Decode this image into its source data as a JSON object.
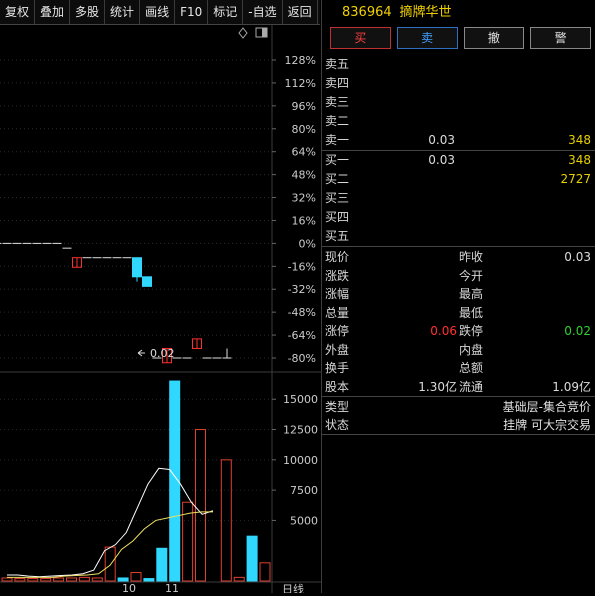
{
  "toolbar": [
    "复权",
    "叠加",
    "多股",
    "统计",
    "画线",
    "F10",
    "标记",
    "-自选",
    "返回"
  ],
  "chart_icons": [
    "diamond-icon",
    "window-icon"
  ],
  "price_axis": [
    "128%",
    "112%",
    "96%",
    "80%",
    "64%",
    "48%",
    "32%",
    "16%",
    "0%",
    "-16%",
    "-32%",
    "-48%",
    "-64%",
    "-80%"
  ],
  "volume_axis": [
    "15000",
    "12500",
    "10000",
    "7500",
    "5000"
  ],
  "date_labels": [
    "10",
    "11"
  ],
  "period_label": "日线",
  "min_label": "0.02",
  "stock": {
    "code": "836964",
    "name": "摘牌华世"
  },
  "trade_buttons": {
    "buy": "买",
    "sell": "卖",
    "cancel": "撤",
    "warn": "警"
  },
  "sell_levels": [
    {
      "label": "卖五",
      "price": "",
      "vol": ""
    },
    {
      "label": "卖四",
      "price": "",
      "vol": ""
    },
    {
      "label": "卖三",
      "price": "",
      "vol": ""
    },
    {
      "label": "卖二",
      "price": "",
      "vol": ""
    },
    {
      "label": "卖一",
      "price": "0.03",
      "vol": "348"
    }
  ],
  "buy_levels": [
    {
      "label": "买一",
      "price": "0.03",
      "vol": "348"
    },
    {
      "label": "买二",
      "price": "",
      "vol": "2727"
    },
    {
      "label": "买三",
      "price": "",
      "vol": ""
    },
    {
      "label": "买四",
      "price": "",
      "vol": ""
    },
    {
      "label": "买五",
      "price": "",
      "vol": ""
    }
  ],
  "info": [
    {
      "l1": "现价",
      "v1": "",
      "l2": "昨收",
      "v2": "0.03"
    },
    {
      "l1": "涨跌",
      "v1": "",
      "l2": "今开",
      "v2": ""
    },
    {
      "l1": "涨幅",
      "v1": "",
      "l2": "最高",
      "v2": ""
    },
    {
      "l1": "总量",
      "v1": "",
      "l2": "最低",
      "v2": ""
    },
    {
      "l1": "涨停",
      "v1": "0.06",
      "l2": "跌停",
      "v2": "0.02"
    },
    {
      "l1": "外盘",
      "v1": "",
      "l2": "内盘",
      "v2": ""
    },
    {
      "l1": "换手",
      "v1": "",
      "l2": "总额",
      "v2": ""
    },
    {
      "l1": "股本",
      "v1": "1.30亿",
      "l2": "流通",
      "v2": "1.09亿"
    }
  ],
  "type_info": [
    {
      "label": "类型",
      "value": "基础层-集合竞价"
    },
    {
      "label": "状态",
      "value": "挂牌 可大宗交易"
    }
  ],
  "colors": {
    "up": "#ff3030",
    "down": "#30d8ff",
    "flat": "#e0e0e0",
    "ma5": "#ffffff",
    "ma10": "#f0e060"
  },
  "chart_data": {
    "type": "candlestick",
    "candles": [
      {
        "o": 0.03,
        "c": 0.03,
        "h": 0.03,
        "l": 0.03
      },
      {
        "o": 0.03,
        "c": 0.03,
        "h": 0.03,
        "l": 0.03
      },
      {
        "o": 0.03,
        "c": 0.03,
        "h": 0.03,
        "l": 0.03
      },
      {
        "o": 0.03,
        "c": 0.03,
        "h": 0.03,
        "l": 0.03
      },
      {
        "o": 0.03,
        "c": 0.03,
        "h": 0.03,
        "l": 0.03
      },
      {
        "o": 0.03,
        "c": 0.03,
        "h": 0.03,
        "l": 0.03
      },
      {
        "o": 0.03,
        "c": 0.03,
        "h": 0.03,
        "l": 0.03
      },
      {
        "o": 0.029,
        "c": 0.029,
        "h": 0.029,
        "l": 0.029
      },
      {
        "o": 0.025,
        "c": 0.027,
        "h": 0.027,
        "l": 0.025
      },
      {
        "o": 0.027,
        "c": 0.027,
        "h": 0.027,
        "l": 0.027
      },
      {
        "o": 0.027,
        "c": 0.027,
        "h": 0.027,
        "l": 0.027
      },
      {
        "o": 0.027,
        "c": 0.027,
        "h": 0.027,
        "l": 0.027
      },
      {
        "o": 0.027,
        "c": 0.027,
        "h": 0.027,
        "l": 0.027
      },
      {
        "o": 0.027,
        "c": 0.027,
        "h": 0.027,
        "l": 0.027
      },
      {
        "o": 0.027,
        "c": 0.023,
        "h": 0.027,
        "l": 0.022
      },
      {
        "o": 0.023,
        "c": 0.021,
        "h": 0.023,
        "l": 0.021
      },
      {
        "o": 0.006,
        "c": 0.006,
        "h": 0.006,
        "l": 0.006
      },
      {
        "o": 0.005,
        "c": 0.008,
        "h": 0.008,
        "l": 0.005
      },
      {
        "o": 0.006,
        "c": 0.006,
        "h": 0.006,
        "l": 0.006
      },
      {
        "o": 0.006,
        "c": 0.006,
        "h": 0.006,
        "l": 0.006
      },
      {
        "o": 0.008,
        "c": 0.01,
        "h": 0.01,
        "l": 0.008
      },
      {
        "o": 0.006,
        "c": 0.006,
        "h": 0.006,
        "l": 0.006
      },
      {
        "o": 0.006,
        "c": 0.006,
        "h": 0.006,
        "l": 0.006
      },
      {
        "o": 0.006,
        "c": 0.006,
        "h": 0.008,
        "l": 0.006
      }
    ],
    "volume": [
      250,
      200,
      200,
      200,
      250,
      250,
      300,
      250,
      2800,
      250,
      700,
      200,
      2700,
      16500,
      6500,
      12500,
      0,
      10000,
      300,
      3700,
      1500
    ],
    "volume_up": [
      true,
      true,
      true,
      true,
      true,
      true,
      true,
      true,
      true,
      false,
      true,
      false,
      false,
      false,
      true,
      true,
      false,
      true,
      true,
      false,
      true
    ],
    "ma_lines": [
      {
        "name": "MA5",
        "values": [
          500,
          500,
          400,
          350,
          400,
          450,
          500,
          600,
          900,
          2500,
          3000,
          4000,
          6000,
          8000,
          9300,
          9200,
          8000,
          6500,
          5500,
          5800
        ]
      },
      {
        "name": "MA10",
        "values": [
          300,
          300,
          300,
          300,
          300,
          400,
          450,
          500,
          600,
          1300,
          2600,
          3300,
          4300,
          5000,
          5200,
          5400,
          5600,
          5700,
          5700
        ]
      }
    ],
    "volume_ylim": [
      0,
      17000
    ],
    "price_ylim": [
      -80,
      128
    ]
  }
}
